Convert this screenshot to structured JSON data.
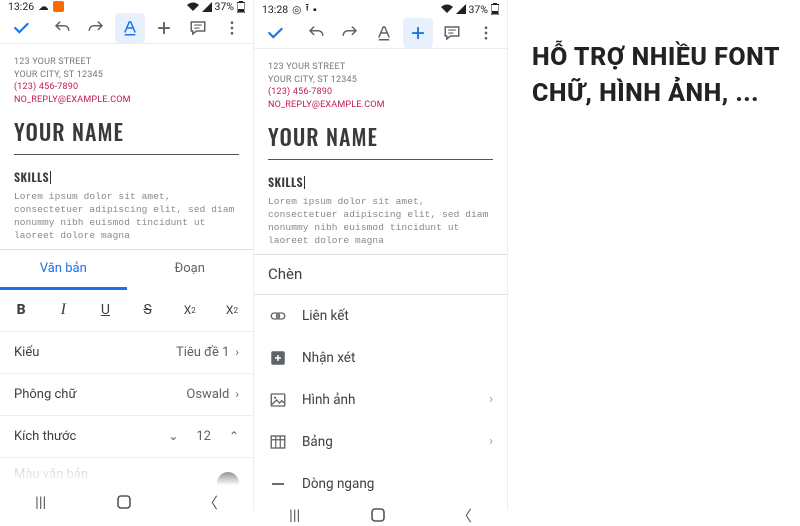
{
  "phones": {
    "left": {
      "status": {
        "time": "13:26",
        "battery": "37%"
      },
      "doc": {
        "address1": "123 YOUR STREET",
        "address2": "YOUR CITY, ST 12345",
        "phone": "(123) 456-7890",
        "email": "NO_REPLY@EXAMPLE.COM",
        "name": "YOUR NAME",
        "section": "SKILLS",
        "lorem": "Lorem ipsum dolor sit amet, consectetuer adipiscing elit, sed diam nonummy nibh euismod tincidunt ut laoreet dolore magna"
      },
      "format_panel": {
        "tab_text": "Văn bản",
        "tab_paragraph": "Đoạn",
        "btn_b": "B",
        "btn_i": "I",
        "btn_u": "U",
        "btn_s": "S",
        "btn_sup": "X",
        "btn_sub": "X",
        "row_style": "Kiểu",
        "row_style_val": "Tiêu đề 1",
        "row_font": "Phông chữ",
        "row_font_val": "Oswald",
        "row_size": "Kích thước",
        "row_size_val": "12",
        "row_color": "Màu văn bản"
      }
    },
    "right": {
      "status": {
        "time": "13:28",
        "battery": "37%"
      },
      "doc": {
        "address1": "123 YOUR STREET",
        "address2": "YOUR CITY, ST 12345",
        "phone": "(123) 456-7890",
        "email": "NO_REPLY@EXAMPLE.COM",
        "name": "YOUR NAME",
        "section": "SKILLS",
        "lorem": "Lorem ipsum dolor sit amet, consectetuer adipiscing elit, sed diam nonummy nibh euismod tincidunt ut laoreet dolore magna"
      },
      "insert_panel": {
        "title": "Chèn",
        "item_link": "Liên kết",
        "item_comment": "Nhận xét",
        "item_image": "Hình ảnh",
        "item_table": "Bảng",
        "item_hr": "Dòng ngang"
      }
    }
  },
  "caption": "HỖ TRỢ NHIỀU FONT CHỮ, HÌNH ẢNH, ..."
}
